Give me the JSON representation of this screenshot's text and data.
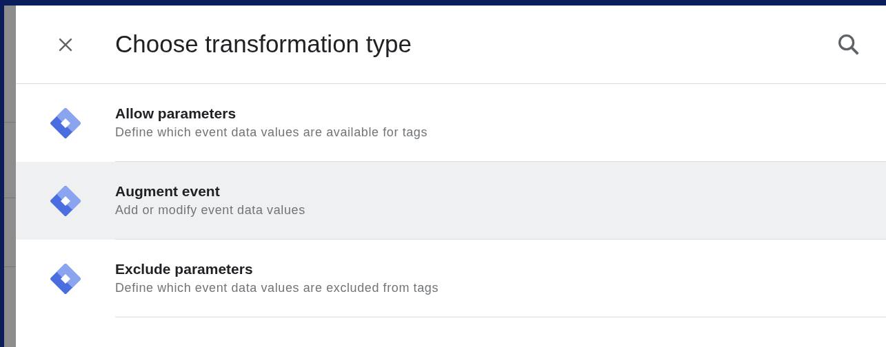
{
  "dialog": {
    "title": "Choose transformation type"
  },
  "items": [
    {
      "title": "Allow parameters",
      "description": "Define which event data values are available for tags",
      "selected": false
    },
    {
      "title": "Augment event",
      "description": "Add or modify event data values",
      "selected": true
    },
    {
      "title": "Exclude parameters",
      "description": "Define which event data values are excluded from tags",
      "selected": false
    }
  ]
}
